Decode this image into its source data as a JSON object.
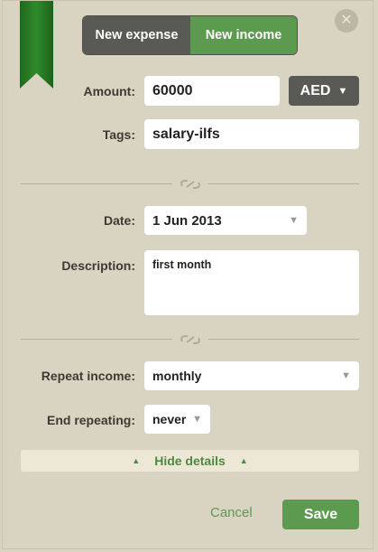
{
  "toggle": {
    "expense_label": "New expense",
    "income_label": "New income",
    "active": "income"
  },
  "close": {
    "icon": "close-icon"
  },
  "amount": {
    "label": "Amount:",
    "value": "60000"
  },
  "currency": {
    "value": "AED"
  },
  "tags": {
    "label": "Tags:",
    "value": "salary-ilfs"
  },
  "date": {
    "label": "Date:",
    "value": "1 Jun 2013"
  },
  "description": {
    "label": "Description:",
    "value": "first month"
  },
  "repeat": {
    "label": "Repeat income:",
    "value": "monthly"
  },
  "end_repeat": {
    "label": "End repeating:",
    "value": "never"
  },
  "details_toggle": {
    "label": "Hide details"
  },
  "actions": {
    "cancel_label": "Cancel",
    "save_label": "Save"
  },
  "colors": {
    "accent": "#5b9a4f",
    "dark": "#595a55",
    "background": "#d9d3c2",
    "ribbon": "#2e7d2a"
  }
}
